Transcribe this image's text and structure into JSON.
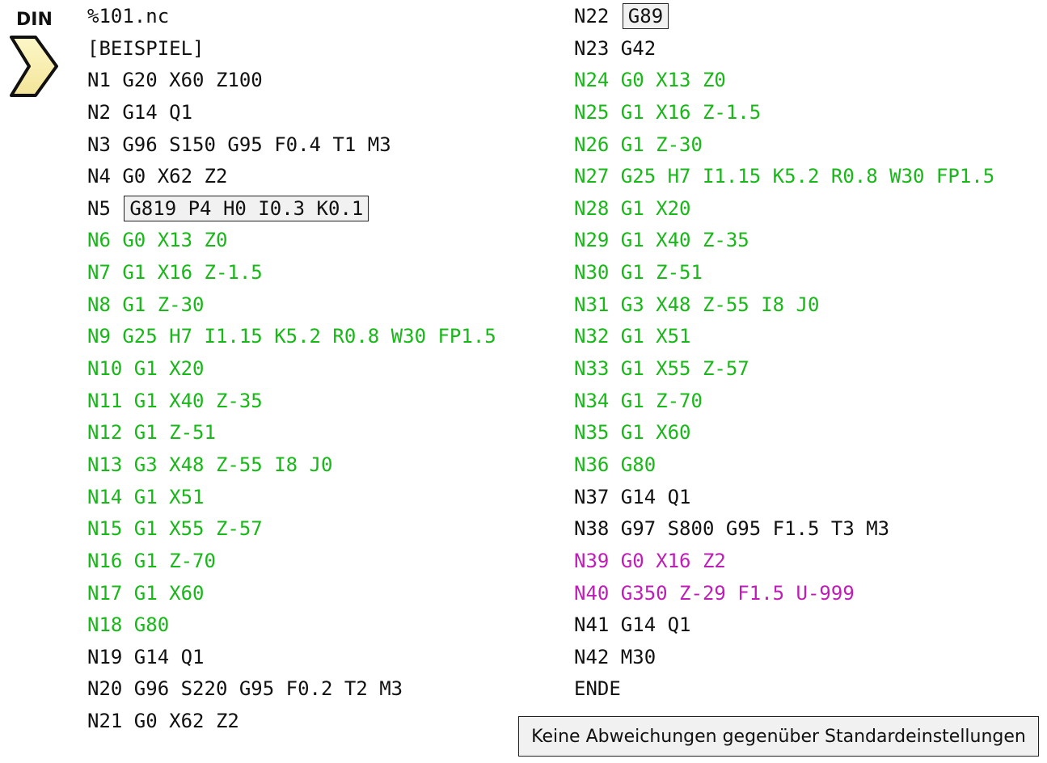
{
  "badge": {
    "label": "DIN",
    "icon": "chevron-right-icon",
    "icon_color": "#fbf3b5"
  },
  "program": {
    "left": [
      {
        "prefix": "%101.nc",
        "boxed": "",
        "suffix": "",
        "color": "black"
      },
      {
        "prefix": "[BEISPIEL]",
        "boxed": "",
        "suffix": "",
        "color": "black"
      },
      {
        "prefix": "N1 G20 X60 Z100",
        "boxed": "",
        "suffix": "",
        "color": "black"
      },
      {
        "prefix": "N2 G14 Q1",
        "boxed": "",
        "suffix": "",
        "color": "black"
      },
      {
        "prefix": "N3 G96 S150 G95 F0.4 T1 M3",
        "boxed": "",
        "suffix": "",
        "color": "black"
      },
      {
        "prefix": "N4 G0 X62 Z2",
        "boxed": "",
        "suffix": "",
        "color": "black"
      },
      {
        "prefix": "N5 ",
        "boxed": "G819 P4 H0 I0.3 K0.1",
        "suffix": "",
        "color": "black"
      },
      {
        "prefix": "N6 G0 X13 Z0",
        "boxed": "",
        "suffix": "",
        "color": "green"
      },
      {
        "prefix": "N7 G1 X16 Z-1.5",
        "boxed": "",
        "suffix": "",
        "color": "green"
      },
      {
        "prefix": "N8 G1 Z-30",
        "boxed": "",
        "suffix": "",
        "color": "green"
      },
      {
        "prefix": "N9 G25 H7 I1.15 K5.2 R0.8 W30 FP1.5",
        "boxed": "",
        "suffix": "",
        "color": "green"
      },
      {
        "prefix": "N10 G1 X20",
        "boxed": "",
        "suffix": "",
        "color": "green"
      },
      {
        "prefix": "N11 G1 X40 Z-35",
        "boxed": "",
        "suffix": "",
        "color": "green"
      },
      {
        "prefix": "N12 G1 Z-51",
        "boxed": "",
        "suffix": "",
        "color": "green"
      },
      {
        "prefix": "N13 G3 X48 Z-55 I8 J0",
        "boxed": "",
        "suffix": "",
        "color": "green"
      },
      {
        "prefix": "N14 G1 X51",
        "boxed": "",
        "suffix": "",
        "color": "green"
      },
      {
        "prefix": "N15 G1 X55 Z-57",
        "boxed": "",
        "suffix": "",
        "color": "green"
      },
      {
        "prefix": "N16 G1 Z-70",
        "boxed": "",
        "suffix": "",
        "color": "green"
      },
      {
        "prefix": "N17 G1 X60",
        "boxed": "",
        "suffix": "",
        "color": "green"
      },
      {
        "prefix": "N18 G80",
        "boxed": "",
        "suffix": "",
        "color": "green"
      },
      {
        "prefix": "N19 G14 Q1",
        "boxed": "",
        "suffix": "",
        "color": "black"
      },
      {
        "prefix": "N20 G96 S220 G95 F0.2 T2 M3",
        "boxed": "",
        "suffix": "",
        "color": "black"
      },
      {
        "prefix": "N21 G0 X62 Z2",
        "boxed": "",
        "suffix": "",
        "color": "black"
      }
    ],
    "right": [
      {
        "prefix": "N22 ",
        "boxed": "G89",
        "suffix": "",
        "color": "black"
      },
      {
        "prefix": "N23 G42",
        "boxed": "",
        "suffix": "",
        "color": "black"
      },
      {
        "prefix": "N24 G0 X13 Z0",
        "boxed": "",
        "suffix": "",
        "color": "green"
      },
      {
        "prefix": "N25 G1 X16 Z-1.5",
        "boxed": "",
        "suffix": "",
        "color": "green"
      },
      {
        "prefix": "N26 G1 Z-30",
        "boxed": "",
        "suffix": "",
        "color": "green"
      },
      {
        "prefix": "N27 G25 H7 I1.15 K5.2 R0.8 W30 FP1.5",
        "boxed": "",
        "suffix": "",
        "color": "green"
      },
      {
        "prefix": "N28 G1 X20",
        "boxed": "",
        "suffix": "",
        "color": "green"
      },
      {
        "prefix": "N29 G1 X40 Z-35",
        "boxed": "",
        "suffix": "",
        "color": "green"
      },
      {
        "prefix": "N30 G1 Z-51",
        "boxed": "",
        "suffix": "",
        "color": "green"
      },
      {
        "prefix": "N31 G3 X48 Z-55 I8 J0",
        "boxed": "",
        "suffix": "",
        "color": "green"
      },
      {
        "prefix": "N32 G1 X51",
        "boxed": "",
        "suffix": "",
        "color": "green"
      },
      {
        "prefix": "N33 G1 X55 Z-57",
        "boxed": "",
        "suffix": "",
        "color": "green"
      },
      {
        "prefix": "N34 G1 Z-70",
        "boxed": "",
        "suffix": "",
        "color": "green"
      },
      {
        "prefix": "N35 G1 X60",
        "boxed": "",
        "suffix": "",
        "color": "green"
      },
      {
        "prefix": "N36 G80",
        "boxed": "",
        "suffix": "",
        "color": "green"
      },
      {
        "prefix": "N37 G14 Q1",
        "boxed": "",
        "suffix": "",
        "color": "black"
      },
      {
        "prefix": "N38 G97 S800 G95 F1.5 T3 M3",
        "boxed": "",
        "suffix": "",
        "color": "black"
      },
      {
        "prefix": "N39 G0 X16 Z2",
        "boxed": "",
        "suffix": "",
        "color": "magenta"
      },
      {
        "prefix": "N40 G350 Z-29 F1.5 U-999",
        "boxed": "",
        "suffix": "",
        "color": "magenta"
      },
      {
        "prefix": "N41 G14 Q1",
        "boxed": "",
        "suffix": "",
        "color": "black"
      },
      {
        "prefix": "N42 M30",
        "boxed": "",
        "suffix": "",
        "color": "black"
      },
      {
        "prefix": "ENDE",
        "boxed": "",
        "suffix": "",
        "color": "black"
      }
    ]
  },
  "colors": {
    "black": "#111111",
    "green": "#17b817",
    "magenta": "#c01cb8",
    "box_fill": "#f1f1f1"
  },
  "status": {
    "text": "Keine Abweichungen gegenüber Standardeinstellungen"
  }
}
